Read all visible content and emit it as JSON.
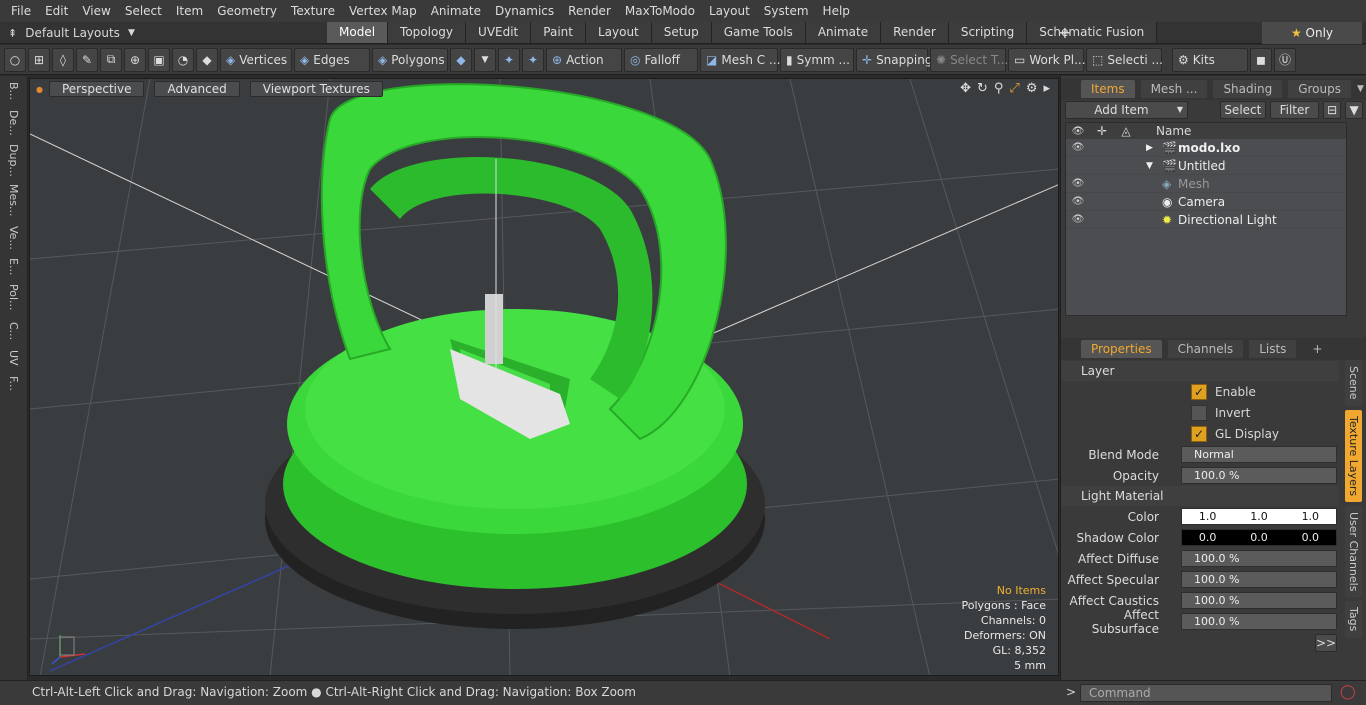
{
  "menu": [
    "File",
    "Edit",
    "View",
    "Select",
    "Item",
    "Geometry",
    "Texture",
    "Vertex Map",
    "Animate",
    "Dynamics",
    "Render",
    "MaxToModo",
    "Layout",
    "System",
    "Help"
  ],
  "layout": {
    "selector": "Default Layouts",
    "tabs": [
      "Model",
      "Topology",
      "UVEdit",
      "Paint",
      "Layout",
      "Setup",
      "Game Tools",
      "Animate",
      "Render",
      "Scripting",
      "Schematic Fusion"
    ],
    "active_tab": "Model",
    "only": "Only"
  },
  "toolbar": {
    "vertices": "Vertices",
    "edges": "Edges",
    "polygons": "Polygons",
    "action": "Action",
    "falloff": "Falloff",
    "mesh": "Mesh C ...",
    "symm": "Symm ...",
    "snapping": "Snapping",
    "select_t": "Select T...",
    "work_pl": "Work Pl...",
    "selecti": "Selecti ...",
    "kits": "Kits"
  },
  "left_tabs": [
    "B...",
    "De...",
    "Dup...",
    "Mes...",
    "Ve...",
    "E...",
    "Pol...",
    "C...",
    "UV",
    "F..."
  ],
  "viewport": {
    "perspective": "Perspective",
    "advanced": "Advanced",
    "textures": "Viewport Textures"
  },
  "stats": {
    "no_items": "No Items",
    "polygons": "Polygons : Face",
    "channels": "Channels: 0",
    "deformers": "Deformers: ON",
    "gl": "GL: 8,352",
    "units": "5 mm"
  },
  "items_panel": {
    "tabs": [
      "Items",
      "Mesh ...",
      "Shading",
      "Groups"
    ],
    "add_item": "Add Item",
    "select": "Select",
    "filter": "Filter",
    "name_col": "Name",
    "tree": [
      {
        "label": "modo.lxo",
        "indent": 0
      },
      {
        "label": "Untitled",
        "indent": 0
      },
      {
        "label": "Mesh",
        "indent": 1
      },
      {
        "label": "Camera",
        "indent": 1
      },
      {
        "label": "Directional Light",
        "indent": 1
      }
    ]
  },
  "props_panel": {
    "tabs": [
      "Properties",
      "Channels",
      "Lists"
    ],
    "layer": "Layer",
    "enable": "Enable",
    "invert": "Invert",
    "gl_display": "GL Display",
    "blend_mode_label": "Blend Mode",
    "blend_mode": "Normal",
    "opacity_label": "Opacity",
    "opacity": "100.0 %",
    "light_material": "Light Material",
    "color_label": "Color",
    "color": [
      "1.0",
      "1.0",
      "1.0"
    ],
    "shadow_label": "Shadow Color",
    "shadow": [
      "0.0",
      "0.0",
      "0.0"
    ],
    "affect_diffuse_label": "Affect Diffuse",
    "affect_diffuse": "100.0 %",
    "affect_specular_label": "Affect Specular",
    "affect_specular": "100.0 %",
    "affect_caustics_label": "Affect Caustics",
    "affect_caustics": "100.0 %",
    "affect_subsurface_label": "Affect Subsurface",
    "affect_subsurface": "100.0 %",
    "more": ">>"
  },
  "side_tabs": [
    "Scene",
    "Texture Layers",
    "User Channels",
    "Tags"
  ],
  "status": {
    "hint": "Ctrl-Alt-Left Click and Drag: Navigation: Zoom ● Ctrl-Alt-Right Click and Drag: Navigation: Box Zoom",
    "command_placeholder": "Command"
  }
}
